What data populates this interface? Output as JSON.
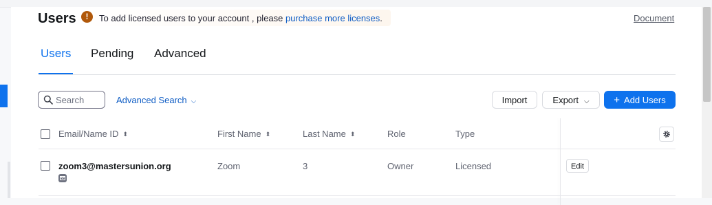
{
  "header": {
    "title": "Users",
    "banner_text": "To add licensed users to your account ,  please ",
    "banner_link": "purchase more licenses",
    "banner_suffix": ".",
    "document_link": "Document"
  },
  "tabs": [
    {
      "label": "Users",
      "active": true
    },
    {
      "label": "Pending",
      "active": false
    },
    {
      "label": "Advanced",
      "active": false
    }
  ],
  "toolbar": {
    "search_placeholder": "Search",
    "advanced_search": "Advanced Search",
    "import_label": "Import",
    "export_label": "Export",
    "add_users_label": "Add Users"
  },
  "table": {
    "columns": [
      "Email/Name ID",
      "First Name",
      "Last Name",
      "Role",
      "Type"
    ],
    "rows": [
      {
        "email": "zoom3@mastersunion.org",
        "first_name": "Zoom",
        "last_name": "3",
        "role": "Owner",
        "type": "Licensed",
        "action": "Edit"
      }
    ]
  },
  "colors": {
    "accent": "#0e72ed",
    "warning": "#b0580a",
    "link": "#0e5cc4"
  },
  "icons": [
    "warning-icon",
    "search-icon",
    "chevron-down-icon",
    "plus-icon",
    "sort-icon",
    "gear-icon",
    "mail-icon"
  ]
}
